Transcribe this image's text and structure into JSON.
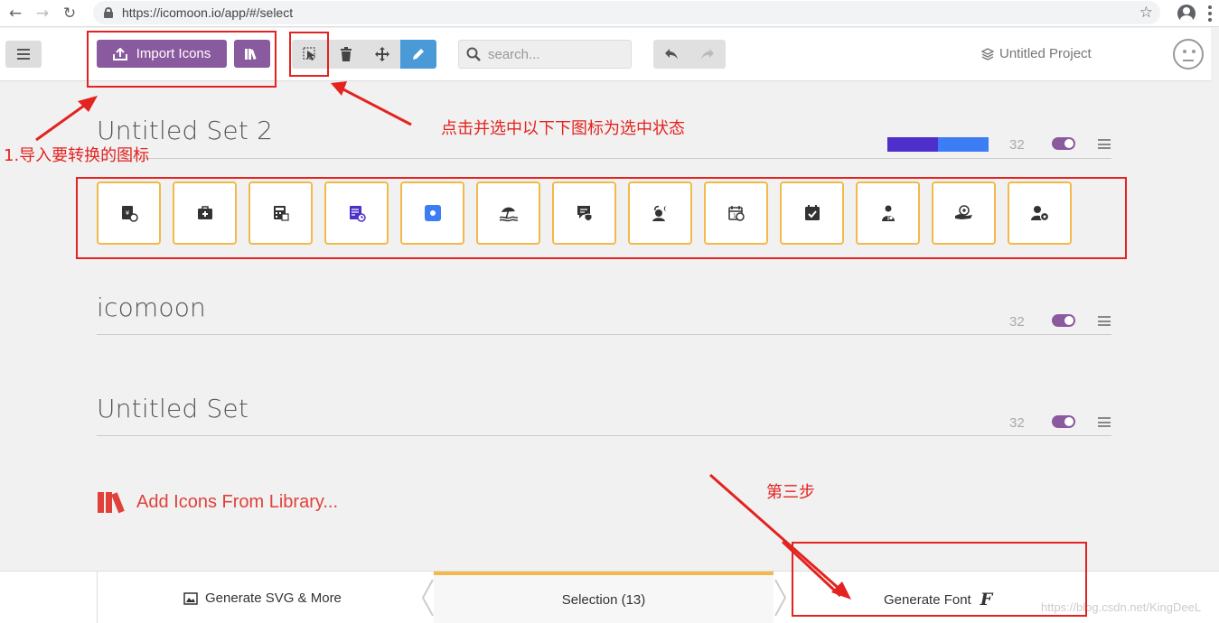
{
  "browser": {
    "url": "https://icomoon.io/app/#/select"
  },
  "toolbar": {
    "import_label": "Import Icons",
    "search_placeholder": "search...",
    "project_name": "Untitled Project"
  },
  "sets": [
    {
      "title": "Untitled Set 2",
      "count": "32"
    },
    {
      "title": "icomoon",
      "count": "32"
    },
    {
      "title": "Untitled Set",
      "count": "32"
    }
  ],
  "colors": {
    "accent_purple": "#8a5a9e",
    "highlight_yellow": "#f3b94a",
    "annotation_red": "#e3231f",
    "swatch_1": "#4e2fc9",
    "swatch_2": "#3c7cf4"
  },
  "icons": [
    "yen-card-icon",
    "first-aid-kit-icon",
    "calculator-icon",
    "document-clock-icon",
    "blue-square-icon",
    "beach-umbrella-icon",
    "chat-shield-icon",
    "person-moon-icon",
    "calendar-clock-icon",
    "calendar-check-icon",
    "doctor-icon",
    "hand-care-icon",
    "user-badge-icon"
  ],
  "add_library_label": "Add Icons From Library...",
  "bottom": {
    "generate_svg_label": "Generate SVG & More",
    "selection_label": "Selection (13)",
    "generate_font_label": "Generate Font",
    "font_glyph": "F",
    "watermark": "https://blog.csdn.net/KingDeeL"
  },
  "annotations": {
    "step1": "1.导入要转换的图标",
    "step2": "点击并选中以下下图标为选中状态",
    "step3": "第三步"
  }
}
